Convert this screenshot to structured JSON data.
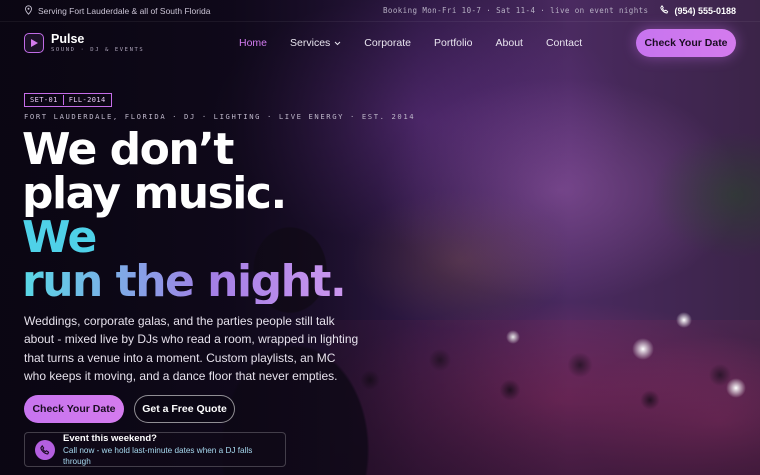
{
  "topbar": {
    "service_area": "Serving Fort Lauderdale & all of South Florida",
    "hours": "Booking Mon-Fri 10-7 · Sat 11-4 · live on event nights",
    "phone": "(954) 555-0188"
  },
  "brand": {
    "name": "Pulse",
    "tagline": "SOUND · DJ & EVENTS"
  },
  "nav": {
    "items": [
      {
        "label": "Home",
        "active": true
      },
      {
        "label": "Services",
        "has_dropdown": true
      },
      {
        "label": "Corporate"
      },
      {
        "label": "Portfolio"
      },
      {
        "label": "About"
      },
      {
        "label": "Contact"
      }
    ],
    "cta": "Check Your Date"
  },
  "hero": {
    "tag_left": "SET-01",
    "tag_right": "FLL-2014",
    "meta": "FORT LAUDERDALE, FLORIDA · DJ · LIGHTING · LIVE ENERGY · EST. 2014",
    "headline_line1": "We don’t",
    "headline_line2": "play music.",
    "headline_line3": "We",
    "headline_line4": "run the night.",
    "lede": "Weddings, corporate galas, and the parties people still talk about - mixed live by DJs who read a room, wrapped in lighting that turns a venue into a moment. Custom playlists, an MC who keeps it moving, and a dance floor that never empties.",
    "primary_button": "Check Your Date",
    "secondary_button": "Get a Free Quote"
  },
  "notice": {
    "title": "Event this weekend?",
    "subtitle": "Call now - we hold last-minute dates when a DJ falls through"
  },
  "colors": {
    "accent": "#c774ef",
    "cyan": "#4fd1e8",
    "background": "#0b0712"
  }
}
